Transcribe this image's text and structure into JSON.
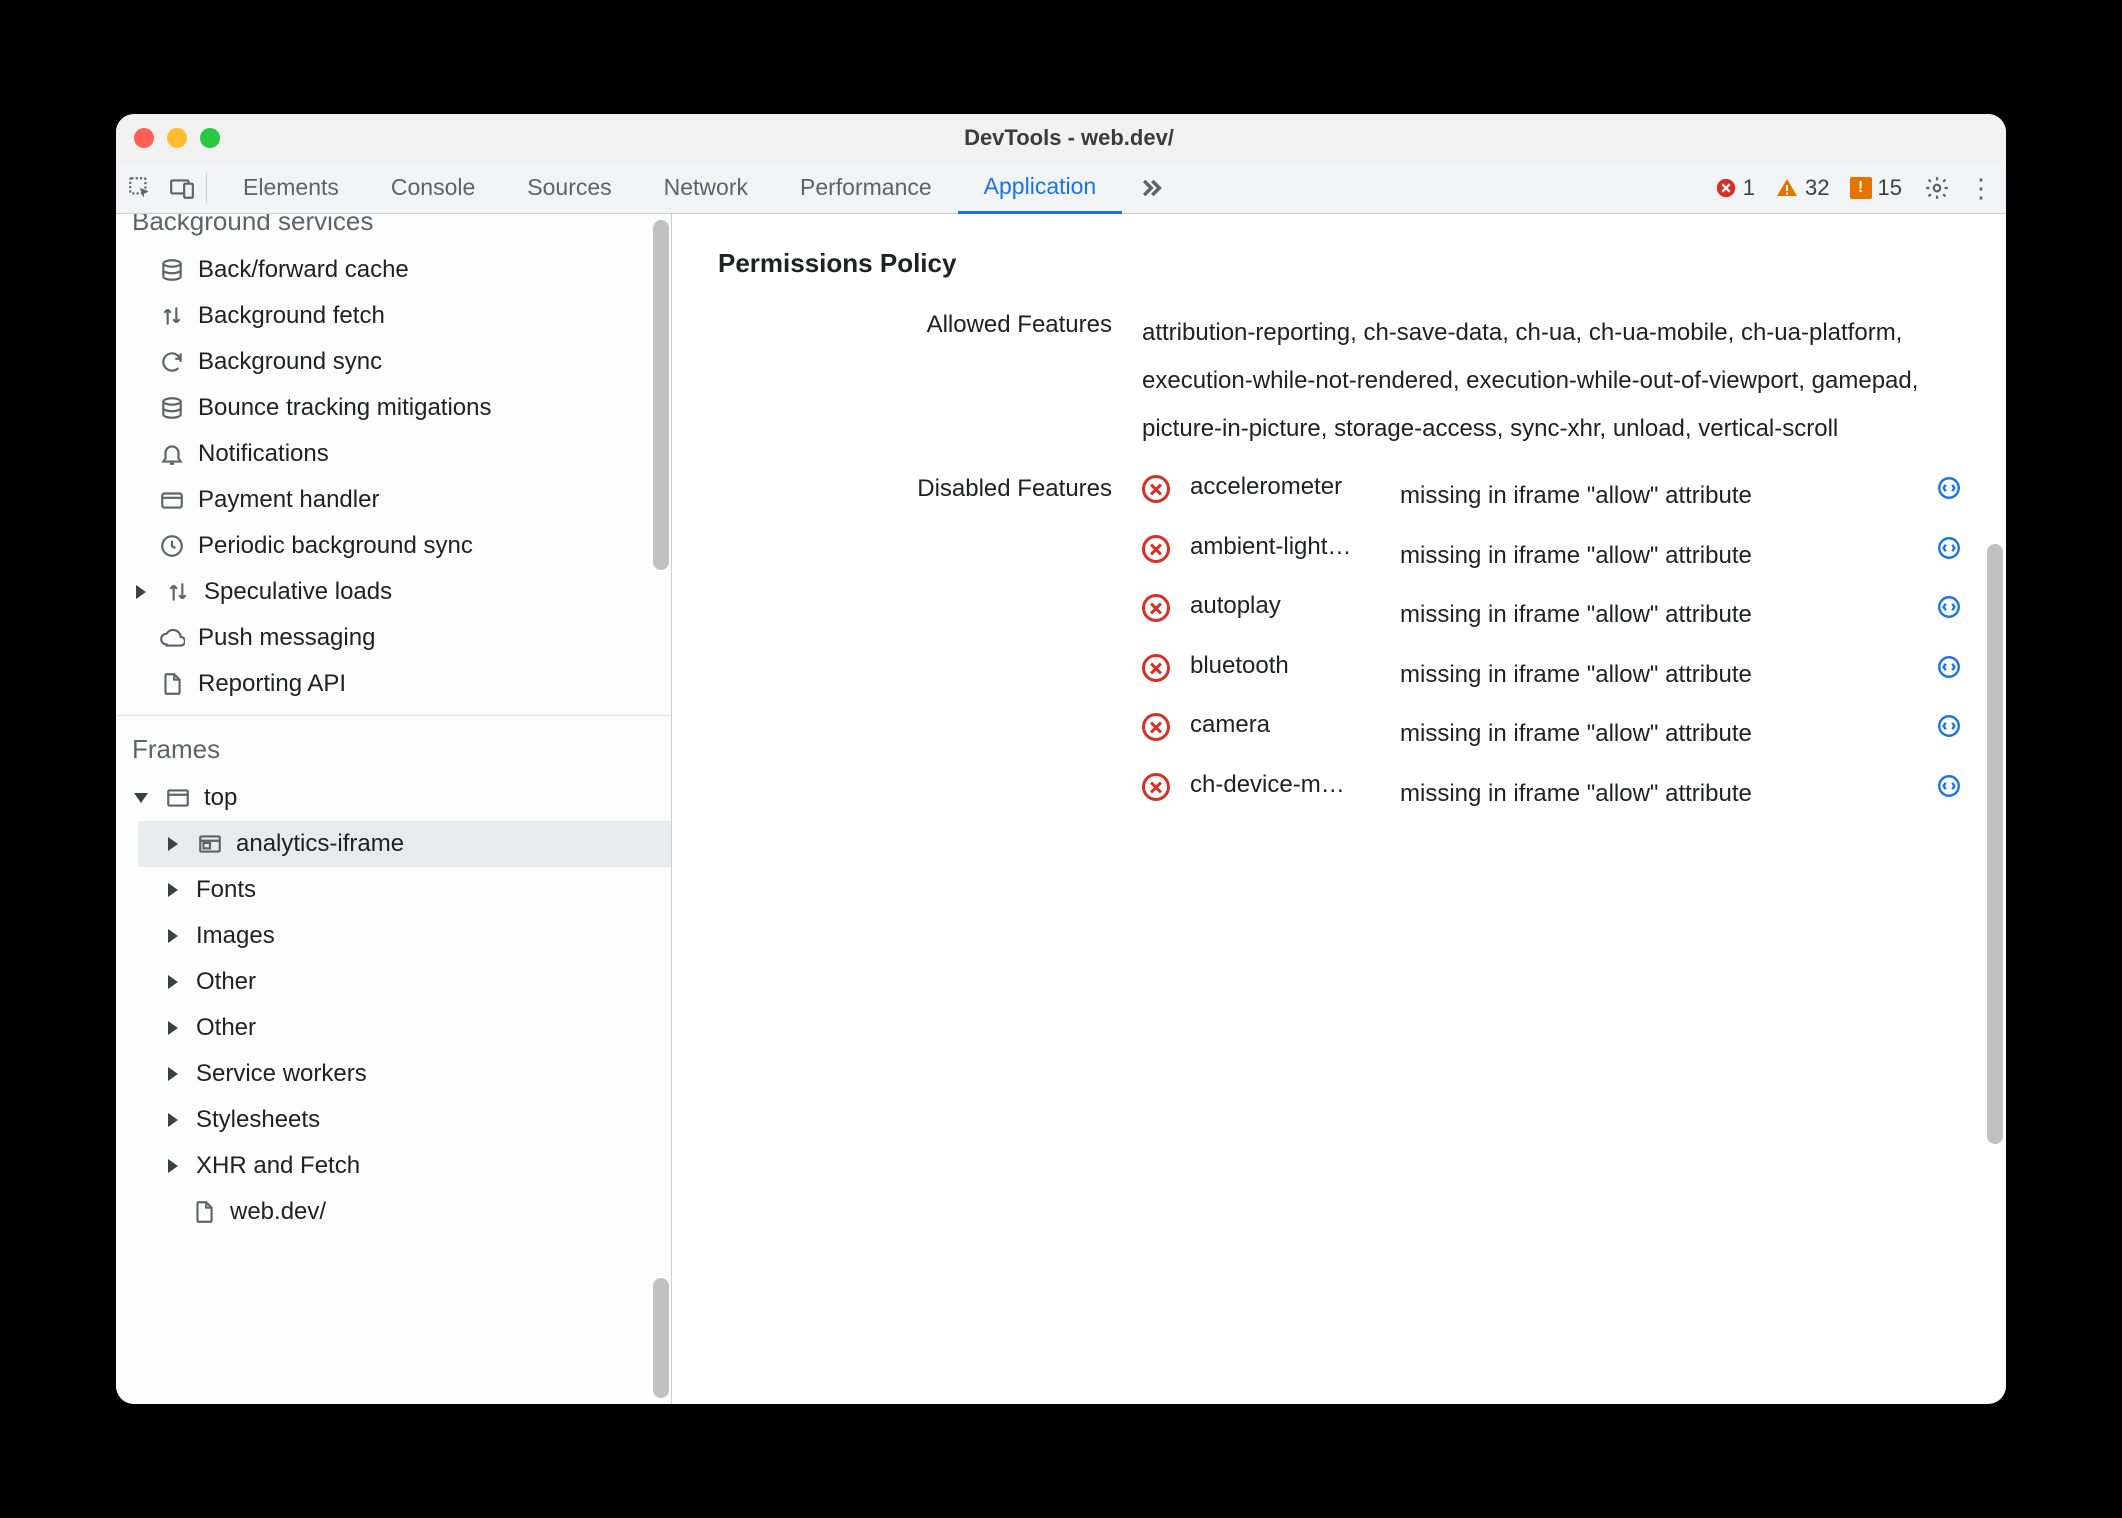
{
  "window": {
    "title": "DevTools - web.dev/"
  },
  "toolbar": {
    "tabs": [
      "Elements",
      "Console",
      "Sources",
      "Network",
      "Performance",
      "Application"
    ],
    "active_tab": "Application",
    "errors": 1,
    "warnings": 32,
    "issues": 15
  },
  "sidebar": {
    "bg_section_title": "Background services",
    "bg_items": [
      {
        "icon": "database",
        "label": "Back/forward cache"
      },
      {
        "icon": "arrows-updown",
        "label": "Background fetch"
      },
      {
        "icon": "sync",
        "label": "Background sync"
      },
      {
        "icon": "database",
        "label": "Bounce tracking mitigations"
      },
      {
        "icon": "bell",
        "label": "Notifications"
      },
      {
        "icon": "card",
        "label": "Payment handler"
      },
      {
        "icon": "clock",
        "label": "Periodic background sync"
      },
      {
        "icon": "arrows-updown",
        "label": "Speculative loads",
        "disclosure": true
      },
      {
        "icon": "cloud",
        "label": "Push messaging"
      },
      {
        "icon": "file",
        "label": "Reporting API"
      }
    ],
    "frames_title": "Frames",
    "frames": {
      "top_label": "top",
      "selected": "analytics-iframe",
      "children": [
        "Fonts",
        "Images",
        "Other",
        "Other",
        "Service workers",
        "Stylesheets",
        "XHR and Fetch"
      ],
      "leaf": "web.dev/"
    }
  },
  "main": {
    "heading": "Permissions Policy",
    "allowed_label": "Allowed Features",
    "allowed_value": "attribution-reporting, ch-save-data, ch-ua, ch-ua-mobile, ch-ua-platform, execution-while-not-rendered, execution-while-out-of-viewport, gamepad, picture-in-picture, storage-access, sync-xhr, unload, vertical-scroll",
    "disabled_label": "Disabled Features",
    "disabled_reason": "missing in iframe \"allow\" attribute",
    "disabled_features": [
      "accelerometer",
      "ambient-light…",
      "autoplay",
      "bluetooth",
      "camera",
      "ch-device-m…"
    ]
  }
}
